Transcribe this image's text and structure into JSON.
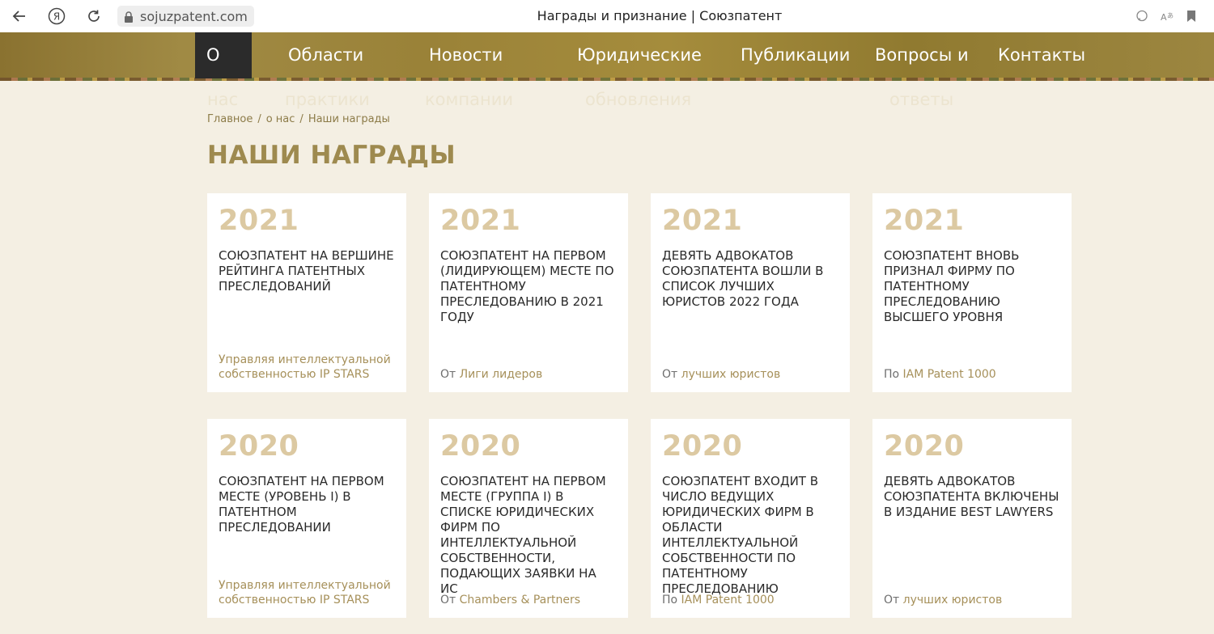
{
  "browser": {
    "url": "sojuzpatent.com",
    "tab_title": "Награды и признание | Союзпатент"
  },
  "nav": {
    "items": [
      {
        "line1": "О",
        "line2": "нас"
      },
      {
        "line1": "Области",
        "line2": "практики"
      },
      {
        "line1": "Новости",
        "line2": "компании"
      },
      {
        "line1": "Юридические",
        "line2": "обновления"
      },
      {
        "line1": "Публикации",
        "line2": ""
      },
      {
        "line1": "Вопросы и",
        "line2": "ответы"
      },
      {
        "line1": "Контакты",
        "line2": ""
      }
    ]
  },
  "breadcrumb": {
    "home": "Главное",
    "about": "о нас",
    "current": "Наши награды",
    "separator": "/"
  },
  "page_title": "НАШИ НАГРАДЫ",
  "awards": [
    {
      "year": "2021",
      "title": "Союзпатент на вершине рейтинга патентных преследований",
      "prefix": "",
      "source": "Управляя интеллектуальной собственностью IP STARS"
    },
    {
      "year": "2021",
      "title": "Союзпатент на первом (лидирующем) месте по патентному преследованию в 2021 году",
      "prefix": "От ",
      "source": "Лиги лидеров"
    },
    {
      "year": "2021",
      "title": "Девять адвокатов Союзпатента вошли в список лучших юристов 2022 года",
      "prefix": "От ",
      "source": "лучших юристов"
    },
    {
      "year": "2021",
      "title": "Союзпатент вновь признал фирму по патентному преследованию высшего уровня",
      "prefix": "По ",
      "source": "IAM Patent 1000"
    },
    {
      "year": "2020",
      "title": "Союзпатент на первом месте (уровень I) в патентном преследовании",
      "prefix": "",
      "source": "Управляя интеллектуальной собственностью IP STARS"
    },
    {
      "year": "2020",
      "title": "Союзпатент на первом месте (группа I) в списке юридических фирм по интеллектуальной собственности, подающих заявки на ИС",
      "prefix": "От ",
      "source": "Chambers & Partners"
    },
    {
      "year": "2020",
      "title": "Союзпатент входит в число ведущих юридических фирм в области интеллектуальной собственности по патентному преследованию",
      "prefix": "По ",
      "source": "IAM Patent 1000"
    },
    {
      "year": "2020",
      "title": "Девять адвокатов Союзпатента включены в издание Best Lawyers",
      "prefix": "От ",
      "source": "лучших юристов"
    }
  ],
  "colors": {
    "page_bg": "#f4efe3",
    "accent": "#9e8a4f",
    "year": "#dcc9a2",
    "link": "#a6905a",
    "nav_active": "#2b2b2b"
  }
}
